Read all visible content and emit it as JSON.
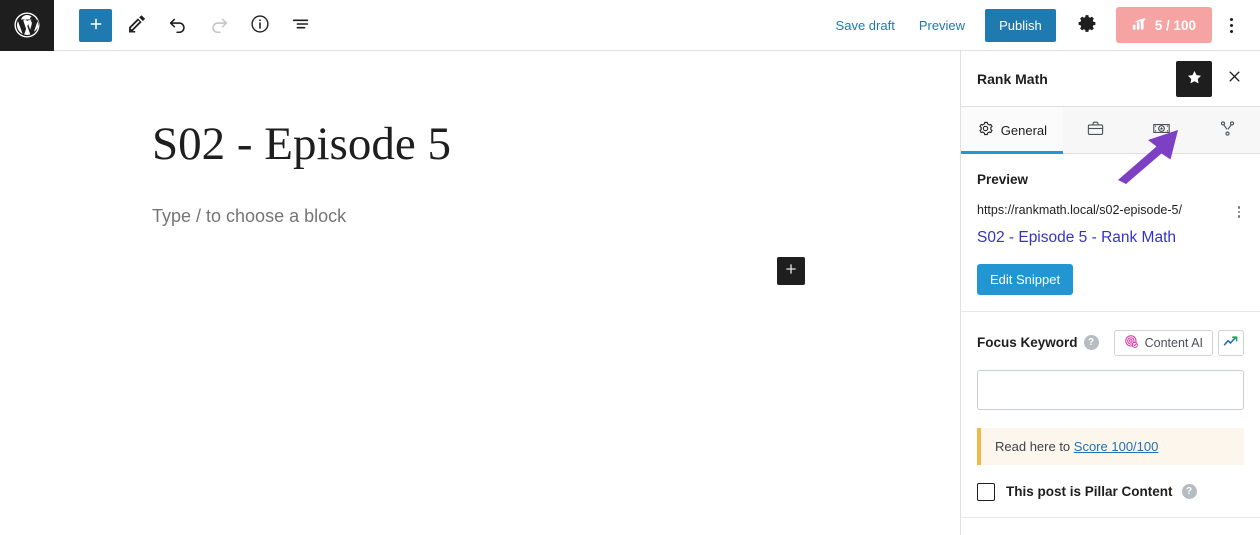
{
  "topbar": {
    "logo_icon": "wordpress-logo-icon",
    "add_block_label": "+",
    "add_block_icon": "plus-icon",
    "edit_icon": "pencil-icon",
    "undo_icon": "undo-arrow-icon",
    "redo_icon": "redo-arrow-icon",
    "info_icon": "info-circle-icon",
    "listview_icon": "list-view-icon",
    "save_draft_label": "Save draft",
    "preview_label": "Preview",
    "publish_label": "Publish",
    "settings_icon": "gear-icon",
    "score_icon": "seo-bar-chart-icon",
    "score_label": "5 / 100",
    "score_color": "#f5a3a3",
    "more_icon": "kebab-menu-icon",
    "accent_color": "#1e7aaf"
  },
  "editor": {
    "post_title": "S02 - Episode 5",
    "block_placeholder": "Type / to choose a block",
    "block_inserter_icon": "plus-icon"
  },
  "sidebar": {
    "title": "Rank Math",
    "star_icon": "star-icon",
    "close_icon": "close-x-icon",
    "tabs": [
      {
        "label": "General",
        "icon": "gear-icon",
        "active": true
      },
      {
        "label": "",
        "icon": "briefcase-icon",
        "active": false
      },
      {
        "label": "",
        "icon": "schema-badge-icon",
        "active": false
      },
      {
        "label": "",
        "icon": "social-share-icon",
        "active": false
      }
    ],
    "active_tab_color": "#2196d3",
    "preview": {
      "heading": "Preview",
      "url": "https://rankmath.local/s02-episode-5/",
      "kebab_icon": "kebab-menu-icon",
      "snippet_title": "S02 - Episode 5 - Rank Math",
      "edit_snippet_label": "Edit Snippet",
      "edit_snippet_color": "#2196d3",
      "snippet_title_color": "#3434c4"
    },
    "focus_keyword": {
      "label": "Focus Keyword",
      "help_icon": "help-question-icon",
      "content_ai_label": "Content AI",
      "content_ai_icon": "content-ai-fingerprint-icon",
      "trend_icon": "trending-chart-icon",
      "input_value": "",
      "input_placeholder": ""
    },
    "notice": {
      "text_prefix": "Read here to ",
      "link_label": "Score 100/100",
      "border_color": "#f0b849",
      "background_color": "#fdf6ec"
    },
    "pillar": {
      "label": "This post is Pillar Content",
      "checked": false,
      "help_icon": "help-question-icon"
    }
  },
  "annotation": {
    "arrow_icon": "purple-pointer-arrow-icon",
    "color": "#7d3fc4"
  }
}
